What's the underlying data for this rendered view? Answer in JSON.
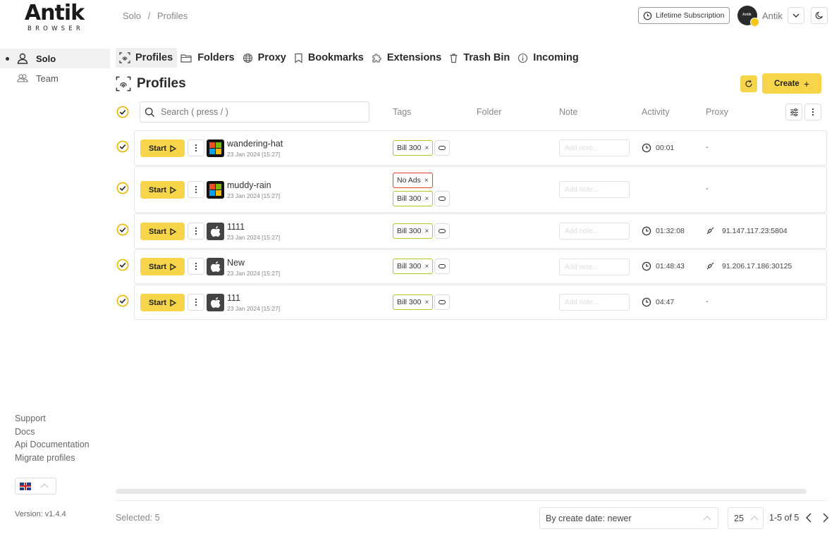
{
  "app": {
    "logo_main": "Antik",
    "logo_sub": "BROWSER",
    "version": "Version: v1.4.4"
  },
  "sidebar": {
    "items": [
      {
        "label": "Solo",
        "icon": "user-icon",
        "active": true
      },
      {
        "label": "Team",
        "icon": "users-icon",
        "active": false
      }
    ],
    "links": [
      "Support",
      "Docs",
      "Api Documentation",
      "Migrate profiles"
    ],
    "language": "en-gb-flag"
  },
  "header": {
    "breadcrumb": [
      "Solo",
      "/",
      "Profiles"
    ],
    "subscription_label": "Lifetime Subscription",
    "avatar_text": "Antik",
    "user_name": "Antik"
  },
  "tabs": [
    {
      "label": "Profiles",
      "icon": "fingerprint-icon",
      "active": true
    },
    {
      "label": "Folders",
      "icon": "folder-icon"
    },
    {
      "label": "Proxy",
      "icon": "globe-icon"
    },
    {
      "label": "Bookmarks",
      "icon": "bookmark-icon"
    },
    {
      "label": "Extensions",
      "icon": "puzzle-icon"
    },
    {
      "label": "Trash Bin",
      "icon": "trash-icon"
    },
    {
      "label": "Incoming",
      "icon": "info-icon"
    }
  ],
  "page": {
    "title": "Profiles",
    "create_label": "Create"
  },
  "table": {
    "search_placeholder": "Search ( press / )",
    "columns": [
      "Tags",
      "Folder",
      "Note",
      "Activity",
      "Proxy"
    ],
    "start_label": "Start",
    "note_placeholder": "Add note...",
    "rows": [
      {
        "name": "wandering-hat",
        "date": "23 Jan 2024 [15:27]",
        "os": "windows",
        "tags": [
          "Bill 300"
        ],
        "activity": "00:01",
        "proxy": "-"
      },
      {
        "name": "muddy-rain",
        "date": "23 Jan 2024 [15:27]",
        "os": "windows",
        "tags": [
          "No Ads",
          "Bill 300"
        ],
        "activity": "",
        "proxy": "-"
      },
      {
        "name": "1111",
        "date": "23 Jan 2024 [15:27]",
        "os": "macos",
        "tags": [
          "Bill 300"
        ],
        "activity": "01:32:08",
        "proxy": "91.147.117.23:5804"
      },
      {
        "name": "New",
        "date": "23 Jan 2024 [15:27]",
        "os": "macos",
        "tags": [
          "Bill 300"
        ],
        "activity": "01:48:43",
        "proxy": "91.206.17.186:30125"
      },
      {
        "name": "111",
        "date": "23 Jan 2024 [15:27]",
        "os": "macos",
        "tags": [
          "Bill 300"
        ],
        "activity": "04:47",
        "proxy": "-"
      }
    ]
  },
  "footer": {
    "selected": "Selected: 5",
    "sort_value": "By create date: newer",
    "per_page": "25",
    "range": "1-5 of 5"
  },
  "colors": {
    "accent": "#f7d54a",
    "tag_green": "#b9c52a",
    "tag_red": "#e0452a"
  }
}
